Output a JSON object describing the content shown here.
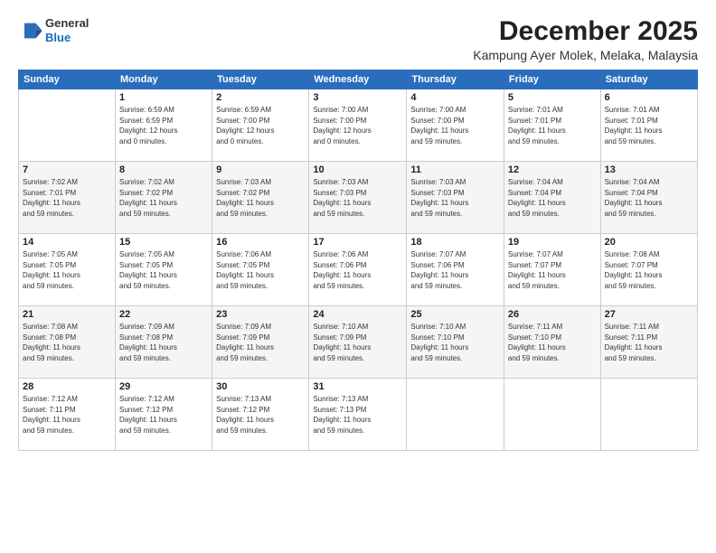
{
  "header": {
    "logo_line1": "General",
    "logo_line2": "Blue",
    "month": "December 2025",
    "location": "Kampung Ayer Molek, Melaka, Malaysia"
  },
  "days_of_week": [
    "Sunday",
    "Monday",
    "Tuesday",
    "Wednesday",
    "Thursday",
    "Friday",
    "Saturday"
  ],
  "weeks": [
    [
      {
        "day": "",
        "info": ""
      },
      {
        "day": "1",
        "info": "Sunrise: 6:59 AM\nSunset: 6:59 PM\nDaylight: 12 hours\nand 0 minutes."
      },
      {
        "day": "2",
        "info": "Sunrise: 6:59 AM\nSunset: 7:00 PM\nDaylight: 12 hours\nand 0 minutes."
      },
      {
        "day": "3",
        "info": "Sunrise: 7:00 AM\nSunset: 7:00 PM\nDaylight: 12 hours\nand 0 minutes."
      },
      {
        "day": "4",
        "info": "Sunrise: 7:00 AM\nSunset: 7:00 PM\nDaylight: 11 hours\nand 59 minutes."
      },
      {
        "day": "5",
        "info": "Sunrise: 7:01 AM\nSunset: 7:01 PM\nDaylight: 11 hours\nand 59 minutes."
      },
      {
        "day": "6",
        "info": "Sunrise: 7:01 AM\nSunset: 7:01 PM\nDaylight: 11 hours\nand 59 minutes."
      }
    ],
    [
      {
        "day": "7",
        "info": "Sunrise: 7:02 AM\nSunset: 7:01 PM\nDaylight: 11 hours\nand 59 minutes."
      },
      {
        "day": "8",
        "info": "Sunrise: 7:02 AM\nSunset: 7:02 PM\nDaylight: 11 hours\nand 59 minutes."
      },
      {
        "day": "9",
        "info": "Sunrise: 7:03 AM\nSunset: 7:02 PM\nDaylight: 11 hours\nand 59 minutes."
      },
      {
        "day": "10",
        "info": "Sunrise: 7:03 AM\nSunset: 7:03 PM\nDaylight: 11 hours\nand 59 minutes."
      },
      {
        "day": "11",
        "info": "Sunrise: 7:03 AM\nSunset: 7:03 PM\nDaylight: 11 hours\nand 59 minutes."
      },
      {
        "day": "12",
        "info": "Sunrise: 7:04 AM\nSunset: 7:04 PM\nDaylight: 11 hours\nand 59 minutes."
      },
      {
        "day": "13",
        "info": "Sunrise: 7:04 AM\nSunset: 7:04 PM\nDaylight: 11 hours\nand 59 minutes."
      }
    ],
    [
      {
        "day": "14",
        "info": "Sunrise: 7:05 AM\nSunset: 7:05 PM\nDaylight: 11 hours\nand 59 minutes."
      },
      {
        "day": "15",
        "info": "Sunrise: 7:05 AM\nSunset: 7:05 PM\nDaylight: 11 hours\nand 59 minutes."
      },
      {
        "day": "16",
        "info": "Sunrise: 7:06 AM\nSunset: 7:05 PM\nDaylight: 11 hours\nand 59 minutes."
      },
      {
        "day": "17",
        "info": "Sunrise: 7:06 AM\nSunset: 7:06 PM\nDaylight: 11 hours\nand 59 minutes."
      },
      {
        "day": "18",
        "info": "Sunrise: 7:07 AM\nSunset: 7:06 PM\nDaylight: 11 hours\nand 59 minutes."
      },
      {
        "day": "19",
        "info": "Sunrise: 7:07 AM\nSunset: 7:07 PM\nDaylight: 11 hours\nand 59 minutes."
      },
      {
        "day": "20",
        "info": "Sunrise: 7:08 AM\nSunset: 7:07 PM\nDaylight: 11 hours\nand 59 minutes."
      }
    ],
    [
      {
        "day": "21",
        "info": "Sunrise: 7:08 AM\nSunset: 7:08 PM\nDaylight: 11 hours\nand 59 minutes."
      },
      {
        "day": "22",
        "info": "Sunrise: 7:09 AM\nSunset: 7:08 PM\nDaylight: 11 hours\nand 59 minutes."
      },
      {
        "day": "23",
        "info": "Sunrise: 7:09 AM\nSunset: 7:09 PM\nDaylight: 11 hours\nand 59 minutes."
      },
      {
        "day": "24",
        "info": "Sunrise: 7:10 AM\nSunset: 7:09 PM\nDaylight: 11 hours\nand 59 minutes."
      },
      {
        "day": "25",
        "info": "Sunrise: 7:10 AM\nSunset: 7:10 PM\nDaylight: 11 hours\nand 59 minutes."
      },
      {
        "day": "26",
        "info": "Sunrise: 7:11 AM\nSunset: 7:10 PM\nDaylight: 11 hours\nand 59 minutes."
      },
      {
        "day": "27",
        "info": "Sunrise: 7:11 AM\nSunset: 7:11 PM\nDaylight: 11 hours\nand 59 minutes."
      }
    ],
    [
      {
        "day": "28",
        "info": "Sunrise: 7:12 AM\nSunset: 7:11 PM\nDaylight: 11 hours\nand 59 minutes."
      },
      {
        "day": "29",
        "info": "Sunrise: 7:12 AM\nSunset: 7:12 PM\nDaylight: 11 hours\nand 59 minutes."
      },
      {
        "day": "30",
        "info": "Sunrise: 7:13 AM\nSunset: 7:12 PM\nDaylight: 11 hours\nand 59 minutes."
      },
      {
        "day": "31",
        "info": "Sunrise: 7:13 AM\nSunset: 7:13 PM\nDaylight: 11 hours\nand 59 minutes."
      },
      {
        "day": "",
        "info": ""
      },
      {
        "day": "",
        "info": ""
      },
      {
        "day": "",
        "info": ""
      }
    ]
  ]
}
